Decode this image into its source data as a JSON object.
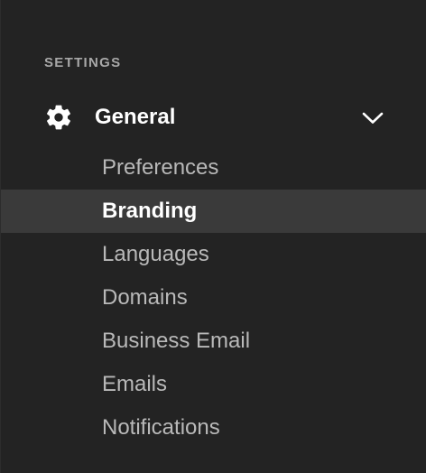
{
  "sidebar": {
    "section_label": "SETTINGS",
    "group": {
      "title": "General",
      "icon": "gear-icon",
      "expand_icon": "chevron-down-icon",
      "expanded": true
    },
    "items": [
      {
        "label": "Preferences",
        "active": false
      },
      {
        "label": "Branding",
        "active": true
      },
      {
        "label": "Languages",
        "active": false
      },
      {
        "label": "Domains",
        "active": false
      },
      {
        "label": "Business Email",
        "active": false
      },
      {
        "label": "Emails",
        "active": false
      },
      {
        "label": "Notifications",
        "active": false
      }
    ]
  },
  "colors": {
    "background": "#232323",
    "active_row": "#3a3a3a",
    "text_primary": "#ffffff",
    "text_secondary": "#b9b9b9",
    "section_label": "#a8a8a8"
  }
}
